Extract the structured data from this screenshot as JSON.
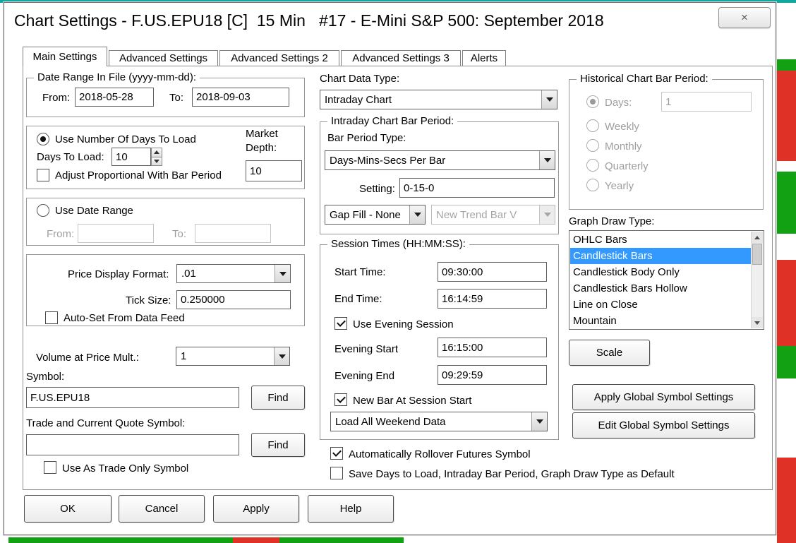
{
  "colors": {
    "selection_bg": "#3399ff",
    "selection_text": "#ffffff",
    "disabled_text": "#9e9e9e",
    "accent_teal": "#0fa8a0",
    "chart_red": "#e03127",
    "chart_green": "#12a112"
  },
  "window": {
    "title": "Chart Settings - F.US.EPU18 [C]  15 Min   #17 - E-Mini S&P 500: September 2018",
    "close_glyph": "×"
  },
  "tabs": {
    "items": [
      "Main Settings",
      "Advanced Settings",
      "Advanced Settings 2",
      "Advanced Settings 3",
      "Alerts"
    ],
    "active": "Main Settings"
  },
  "left": {
    "date_range_group": {
      "legend": "Date Range In File (yyyy-mm-dd):",
      "from_label": "From:",
      "from_value": "2018-05-28",
      "to_label": "To:",
      "to_value": "2018-09-03"
    },
    "days_group": {
      "use_days_radio": {
        "label": "Use Number Of Days To Load",
        "checked": true
      },
      "days_to_load_label": "Days To Load:",
      "days_to_load_value": "10",
      "market_depth_line1": "Market",
      "market_depth_line2": "Depth:",
      "market_depth_value": "10",
      "adjust_checkbox": {
        "label": "Adjust Proportional With Bar Period",
        "checked": false
      }
    },
    "date_range_radio_group": {
      "use_date_range_radio": {
        "label": "Use Date Range",
        "checked": false
      },
      "from_label": "From:",
      "from_value": "",
      "to_label": "To:",
      "to_value": ""
    },
    "price_group": {
      "price_display_format_label": "Price Display Format:",
      "price_display_format_value": ".01",
      "tick_size_label": "Tick Size:",
      "tick_size_value": "0.250000",
      "auto_set_checkbox": {
        "label": "Auto-Set From Data Feed",
        "checked": false
      }
    },
    "volume_at_price_mult_label": "Volume at Price Mult.:",
    "volume_at_price_mult_value": "1",
    "symbol_label": "Symbol:",
    "symbol_value": "F.US.EPU18",
    "symbol_find_button": "Find",
    "trade_symbol_label": "Trade and Current Quote Symbol:",
    "trade_symbol_value": "",
    "trade_find_button": "Find",
    "use_trade_only_checkbox": {
      "label": "Use As Trade Only Symbol",
      "checked": false
    }
  },
  "middle": {
    "chart_data_type_label": "Chart Data Type:",
    "chart_data_type_value": "Intraday Chart",
    "intraday_group": {
      "legend": "Intraday Chart Bar Period:",
      "bar_period_type_label": "Bar Period Type:",
      "bar_period_type_value": "Days-Mins-Secs Per Bar",
      "setting_label": "Setting:",
      "setting_value": "0-15-0",
      "gap_fill_value": "Gap Fill - None",
      "new_trend_bar_value": "New Trend Bar V"
    },
    "session_group": {
      "legend": "Session Times (HH:MM:SS):",
      "start_time_label": "Start Time:",
      "start_time_value": "09:30:00",
      "end_time_label": "End Time:",
      "end_time_value": "16:14:59",
      "use_evening_checkbox": {
        "label": "Use Evening Session",
        "checked": true
      },
      "evening_start_label": "Evening Start",
      "evening_start_value": "16:15:00",
      "evening_end_label": "Evening End",
      "evening_end_value": "09:29:59",
      "new_bar_checkbox": {
        "label": "New Bar At Session Start",
        "checked": true
      },
      "weekend_value": "Load All Weekend Data"
    },
    "rollover_checkbox": {
      "label": "Automatically Rollover Futures Symbol",
      "checked": true
    },
    "save_default_checkbox": {
      "label": "Save Days to Load, Intraday Bar Period, Graph Draw Type as Default",
      "checked": false
    }
  },
  "right": {
    "historical_group": {
      "legend": "Historical Chart Bar Period:",
      "days_radio": {
        "label": "Days:",
        "checked": true,
        "value": "1",
        "disabled": true
      },
      "weekly_radio": {
        "label": "Weekly",
        "checked": false,
        "disabled": true
      },
      "monthly_radio": {
        "label": "Monthly",
        "checked": false,
        "disabled": true
      },
      "quarterly_radio": {
        "label": "Quarterly",
        "checked": false,
        "disabled": true
      },
      "yearly_radio": {
        "label": "Yearly",
        "checked": false,
        "disabled": true
      }
    },
    "graph_draw_type_label": "Graph Draw Type:",
    "graph_draw_type_options": [
      "OHLC Bars",
      "Candlestick Bars",
      "Candlestick Body Only",
      "Candlestick Bars Hollow",
      "Line on Close",
      "Mountain"
    ],
    "graph_draw_type_selected": "Candlestick Bars",
    "scale_button": "Scale",
    "apply_global_button": "Apply Global Symbol Settings",
    "edit_global_button": "Edit Global Symbol Settings"
  },
  "footer": {
    "ok_button": "OK",
    "cancel_button": "Cancel",
    "apply_button": "Apply",
    "help_button": "Help"
  }
}
